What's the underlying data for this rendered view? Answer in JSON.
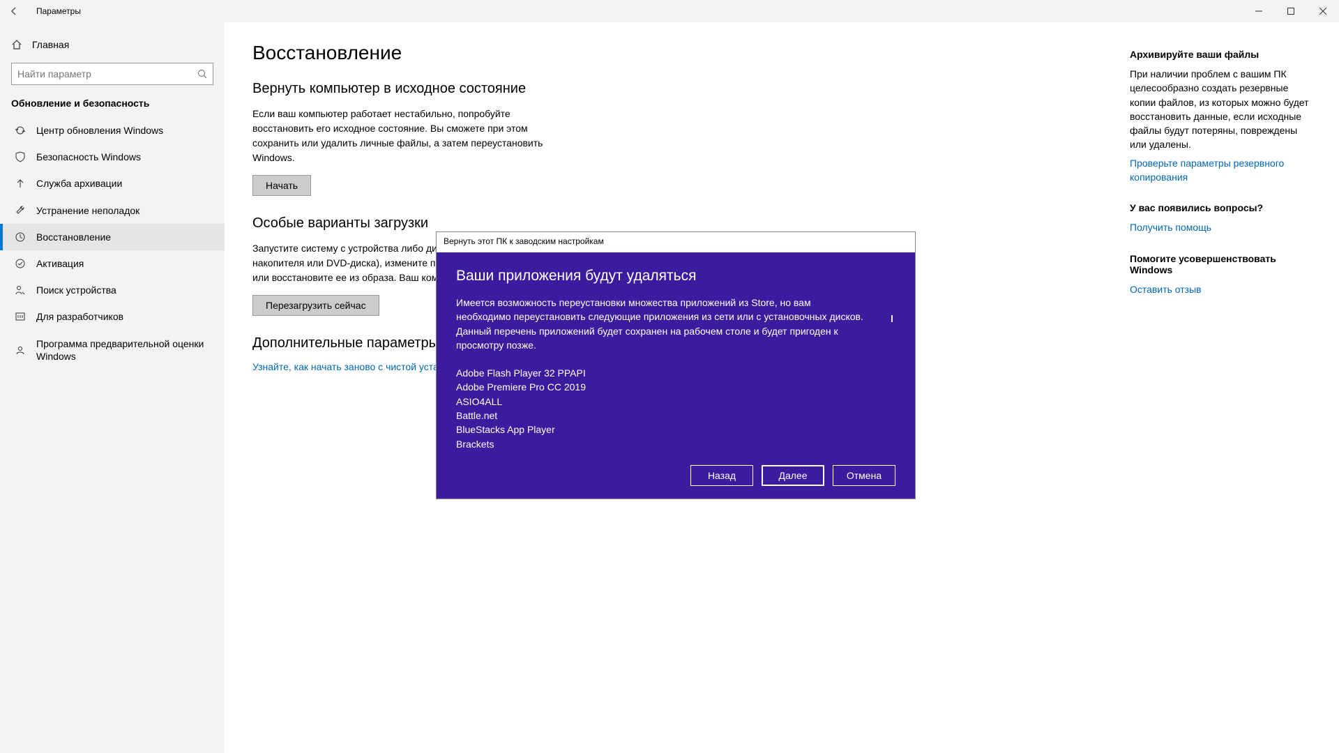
{
  "window": {
    "title": "Параметры"
  },
  "sidebar": {
    "home": "Главная",
    "search_placeholder": "Найти параметр",
    "category": "Обновление и безопасность",
    "items": [
      {
        "label": "Центр обновления Windows"
      },
      {
        "label": "Безопасность Windows"
      },
      {
        "label": "Служба архивации"
      },
      {
        "label": "Устранение неполадок"
      },
      {
        "label": "Восстановление"
      },
      {
        "label": "Активация"
      },
      {
        "label": "Поиск устройства"
      },
      {
        "label": "Для разработчиков"
      },
      {
        "label": "Программа предварительной оценки Windows"
      }
    ]
  },
  "page": {
    "title": "Восстановление",
    "reset": {
      "title": "Вернуть компьютер в исходное состояние",
      "desc": "Если ваш компьютер работает нестабильно, попробуйте восстановить его исходное состояние. Вы сможете при этом сохранить или удалить личные файлы, а затем переустановить Windows.",
      "button": "Начать"
    },
    "advanced_startup": {
      "title": "Особые варианты загрузки",
      "desc": "Запустите систему с устройства либо диска (например, USB-накопителя или DVD-диска), измените параметры загрузки Windows или восстановите ее из образа. Ваш компьютер перезагрузится.",
      "button": "Перезагрузить сейчас"
    },
    "more": {
      "title": "Дополнительные параметры восстановления",
      "link": "Узнайте, как начать заново с чистой установкой Windows"
    }
  },
  "rail": {
    "backup": {
      "title": "Архивируйте ваши файлы",
      "text": "При наличии проблем с вашим ПК целесообразно создать резервные копии файлов, из которых можно будет восстановить данные, если исходные файлы будут потеряны, повреждены или удалены.",
      "link": "Проверьте параметры резервного копирования"
    },
    "questions": {
      "title": "У вас появились вопросы?",
      "link": "Получить помощь"
    },
    "feedback": {
      "title": "Помогите усовершенствовать Windows",
      "link": "Оставить отзыв"
    }
  },
  "dialog": {
    "titlebar": "Вернуть этот ПК к заводским настройкам",
    "heading": "Ваши приложения будут удаляться",
    "desc": "Имеется возможность переустановки множества приложений из Store, но вам необходимо переустановить следующие приложения из сети или с установочных дисков. Данный перечень приложений будет сохранен на рабочем столе и будет пригоден к просмотру позже.",
    "apps": [
      "Adobe Flash Player 32 PPAPI",
      "Adobe Premiere Pro CC 2019",
      "ASIO4ALL",
      "Battle.net",
      "BlueStacks App Player",
      "Brackets"
    ],
    "buttons": {
      "back": "Назад",
      "next": "Далее",
      "cancel": "Отмена"
    }
  }
}
